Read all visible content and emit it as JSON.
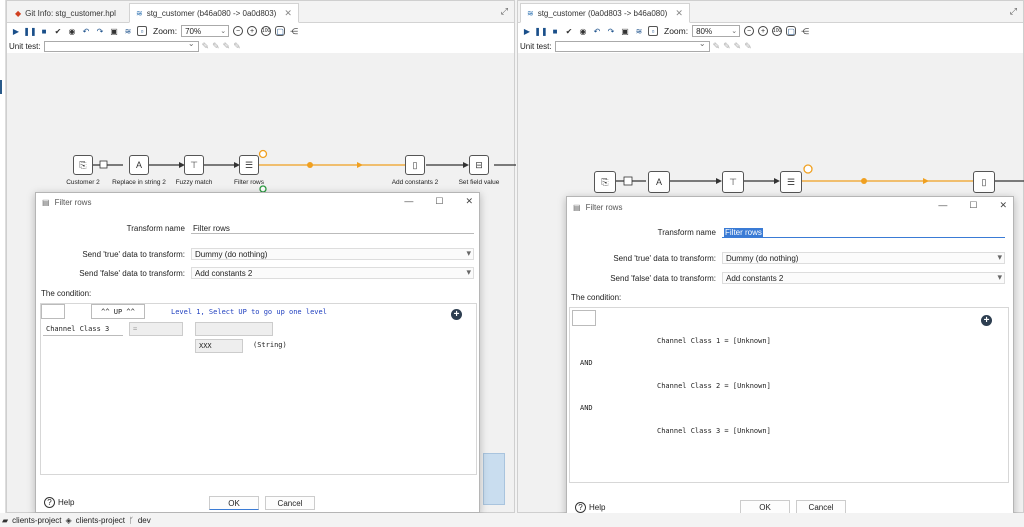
{
  "left_pane": {
    "tabs": [
      {
        "label": "Git Info: stg_customer.hpl",
        "icon": "git-icon"
      },
      {
        "label": "stg_customer (b46a080 -> 0a0d803)",
        "icon": "pipeline-icon"
      }
    ],
    "zoom_label": "Zoom:",
    "zoom_value": "70%",
    "unit_test_label": "Unit test:",
    "nodes": [
      "Customer 2",
      "Replace in string 2",
      "Fuzzy match",
      "Filter rows",
      "Add constants 2",
      "Set field value"
    ],
    "dialog": {
      "title": "Filter rows",
      "transform_name_label": "Transform name",
      "transform_name_value": "Filter rows",
      "true_label": "Send 'true' data to transform:",
      "true_value": "Dummy (do nothing)",
      "false_label": "Send 'false' data to transform:",
      "false_value": "Add constants 2",
      "condition_label": "The condition:",
      "up_button": "^^ UP ^^",
      "level_text": "Level 1, Select UP to go up one level",
      "field": "Channel Class 3",
      "operator": "=",
      "value": "XXX",
      "value_type": "(String)",
      "help_label": "Help",
      "ok_label": "OK",
      "cancel_label": "Cancel"
    }
  },
  "right_pane": {
    "tabs": [
      {
        "label": "stg_customer (0a0d803 -> b46a080)",
        "icon": "pipeline-icon"
      }
    ],
    "zoom_label": "Zoom:",
    "zoom_value": "80%",
    "unit_test_label": "Unit test:",
    "dialog": {
      "title": "Filter rows",
      "transform_name_label": "Transform name",
      "transform_name_value": "Filter rows",
      "true_label": "Send 'true' data to transform:",
      "true_value": "Dummy (do nothing)",
      "false_label": "Send 'false' data to transform:",
      "false_value": "Add constants 2",
      "condition_label": "The condition:",
      "conditions": [
        "Channel Class 1 = [Unknown]",
        "AND",
        "Channel Class 2 = [Unknown]",
        "AND",
        "Channel Class 3 = [Unknown]"
      ],
      "help_label": "Help",
      "ok_label": "OK",
      "cancel_label": "Cancel"
    }
  },
  "status_bar": {
    "project1": "clients-project",
    "project2": "clients-project",
    "branch": "dev"
  },
  "colors": {
    "accent": "#3a7bd5",
    "hop_active": "#f0a020",
    "hop_normal": "#333333",
    "level_text": "#1f3fbf"
  }
}
